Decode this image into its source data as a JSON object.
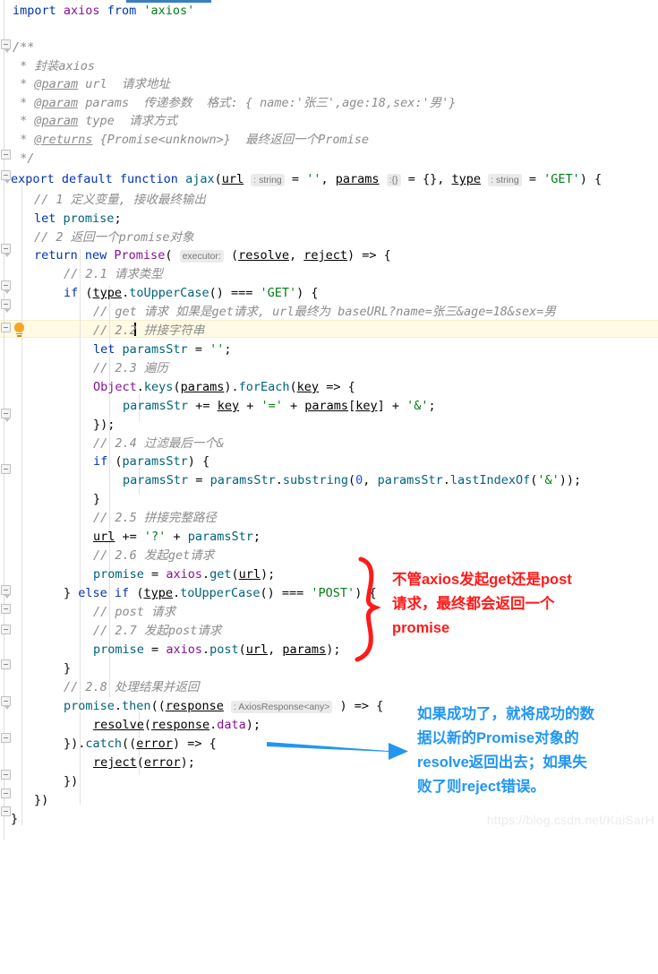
{
  "editor": {
    "tab_underline_color": "#3b7ec0",
    "current_line_highlight": "#fffae3",
    "background": "#ffffff"
  },
  "code": {
    "language": "typescript",
    "lines": [
      "import axios from 'axios'",
      "",
      "/**",
      " * 封装axios",
      " * @param url  请求地址",
      " * @param params  传递参数  格式: { name:'张三',age:18,sex:'男'}",
      " * @param type  请求方式",
      " * @returns {Promise<unknown>}  最终返回一个Promise",
      " */",
      "export default function ajax(url : string  = '', params :{}  = {}, type : string  = 'GET') {",
      "    // 1 定义变量, 接收最终输出",
      "    let promise;",
      "    // 2 返回一个promise对象",
      "    return new Promise( executor: (resolve, reject) => {",
      "        // 2.1 请求类型",
      "        if (type.toUpperCase() === 'GET') {",
      "            // get 请求 如果是get请求, url最终为 baseURL?name=张三&age=18&sex=男",
      "            // 2.2 拼接字符串",
      "            let paramsStr = '';",
      "            // 2.3 遍历",
      "            Object.keys(params).forEach(key => {",
      "                paramsStr += key + '=' + params[key] + '&';",
      "            });",
      "            // 2.4 过滤最后一个&",
      "            if (paramsStr) {",
      "                paramsStr = paramsStr.substring(0, paramsStr.lastIndexOf('&'));",
      "            }",
      "            // 2.5 拼接完整路径",
      "            url += '?' + paramsStr;",
      "            // 2.6 发起get请求",
      "            promise = axios.get(url);",
      "        } else if (type.toUpperCase() === 'POST') {",
      "            // post 请求",
      "            // 2.7 发起post请求",
      "            promise = axios.post(url, params);",
      "        }",
      "        // 2.8 处理结果并返回",
      "        promise.then((response : AxiosResponse<any> ) => {",
      "            resolve(response.data);",
      "        }).catch((error) => {",
      "            reject(error);",
      "        })",
      "    })",
      "}"
    ],
    "inlay_hints": [
      {
        "text": ": string",
        "on_line": 9
      },
      {
        "text": ":{}",
        "on_line": 9
      },
      {
        "text": ": string",
        "on_line": 9
      },
      {
        "text": "executor:",
        "on_line": 13
      },
      {
        "text": ": AxiosResponse<any>",
        "on_line": 35
      }
    ],
    "current_line_number": 17,
    "current_line_text": "            // 2.2 拼接字符串"
  },
  "annotations": {
    "red_note": {
      "color": "#ff1a1a",
      "text": "不管axios发起get还是post\n请求，最终都会返回一个\npromise",
      "marker": "curly-brace"
    },
    "blue_note": {
      "color": "#2196f3",
      "text": "如果成功了，就将成功的数\n据以新的Promise对象的\nresolve返回出去；如果失\n败了则reject错误。",
      "marker": "arrow"
    }
  },
  "watermark": {
    "text": "https://blog.csdn.net/KaiSarH"
  }
}
